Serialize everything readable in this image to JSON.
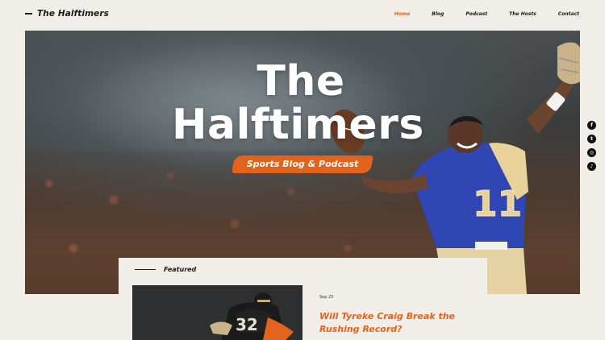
{
  "header": {
    "logo": "The Halftimers",
    "nav": [
      "Home",
      "Blog",
      "Podcast",
      "The Hosts",
      "Contact"
    ],
    "active_index": 0
  },
  "hero": {
    "title_line1": "The",
    "title_line2": "Halftimers",
    "tagline": "Sports Blog & Podcast",
    "jersey_number": "11"
  },
  "social": {
    "icons": [
      "facebook-icon",
      "twitter-icon",
      "instagram-icon",
      "tiktok-icon"
    ],
    "glyphs": [
      "f",
      "t",
      "◎",
      "♪"
    ]
  },
  "featured": {
    "label": "Featured",
    "post": {
      "date": "Sep 25",
      "title": "Will Tyreke Craig Break the Rushing Record?"
    }
  },
  "colors": {
    "accent": "#e2631c",
    "background": "#f1eeea",
    "jersey": "#2f46b3"
  }
}
